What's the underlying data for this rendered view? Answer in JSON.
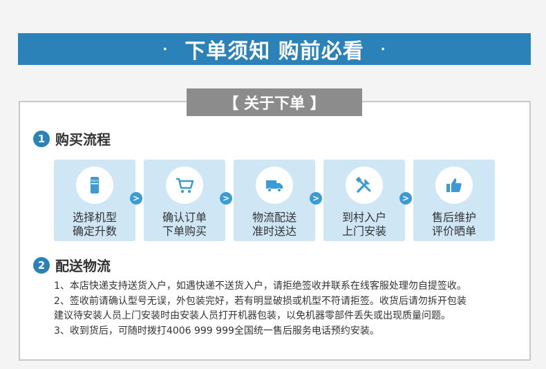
{
  "banner": {
    "dot_left": "·",
    "title": "下单须知 购前必看",
    "dot_right": "·"
  },
  "section_label": "【 关于下单 】",
  "purchase": {
    "number": "1",
    "title": "购买流程",
    "arrow_glyph": ">",
    "steps": [
      {
        "icon": "haier-fridge-icon",
        "line1": "选择机型",
        "line2": "确定升数"
      },
      {
        "icon": "shopping-cart-icon",
        "line1": "确认订单",
        "line2": "下单购买"
      },
      {
        "icon": "delivery-truck-icon",
        "line1": "物流配送",
        "line2": "准时送达"
      },
      {
        "icon": "tools-icon",
        "line1": "到村入户",
        "line2": "上门安装"
      },
      {
        "icon": "thumbs-up-icon",
        "line1": "售后维护",
        "line2": "评价晒单"
      }
    ]
  },
  "shipping": {
    "number": "2",
    "title": "配送物流",
    "notes": [
      "1、本店快递支持送货入户，如遇快递不送货入户，请拒绝签收并联系在线客服处理勿自提签收。",
      "2、签收前请确认型号无误，外包装完好，若有明显破损或机型不符请拒签。收货后请勿拆开包装",
      "建议待安装人员上门安装时由安装人员打开机器包装，以免机器零部件丢失或出现质量问题。",
      "3、收到货后，可随时拨打4006 999 999全国统一售后服务电话预约安装。"
    ]
  },
  "colors": {
    "accent": "#2a82b8",
    "step_bg": "#cfe6f5",
    "icon_blue": "#3b9bd4",
    "label_gray": "#8c8c8c"
  }
}
